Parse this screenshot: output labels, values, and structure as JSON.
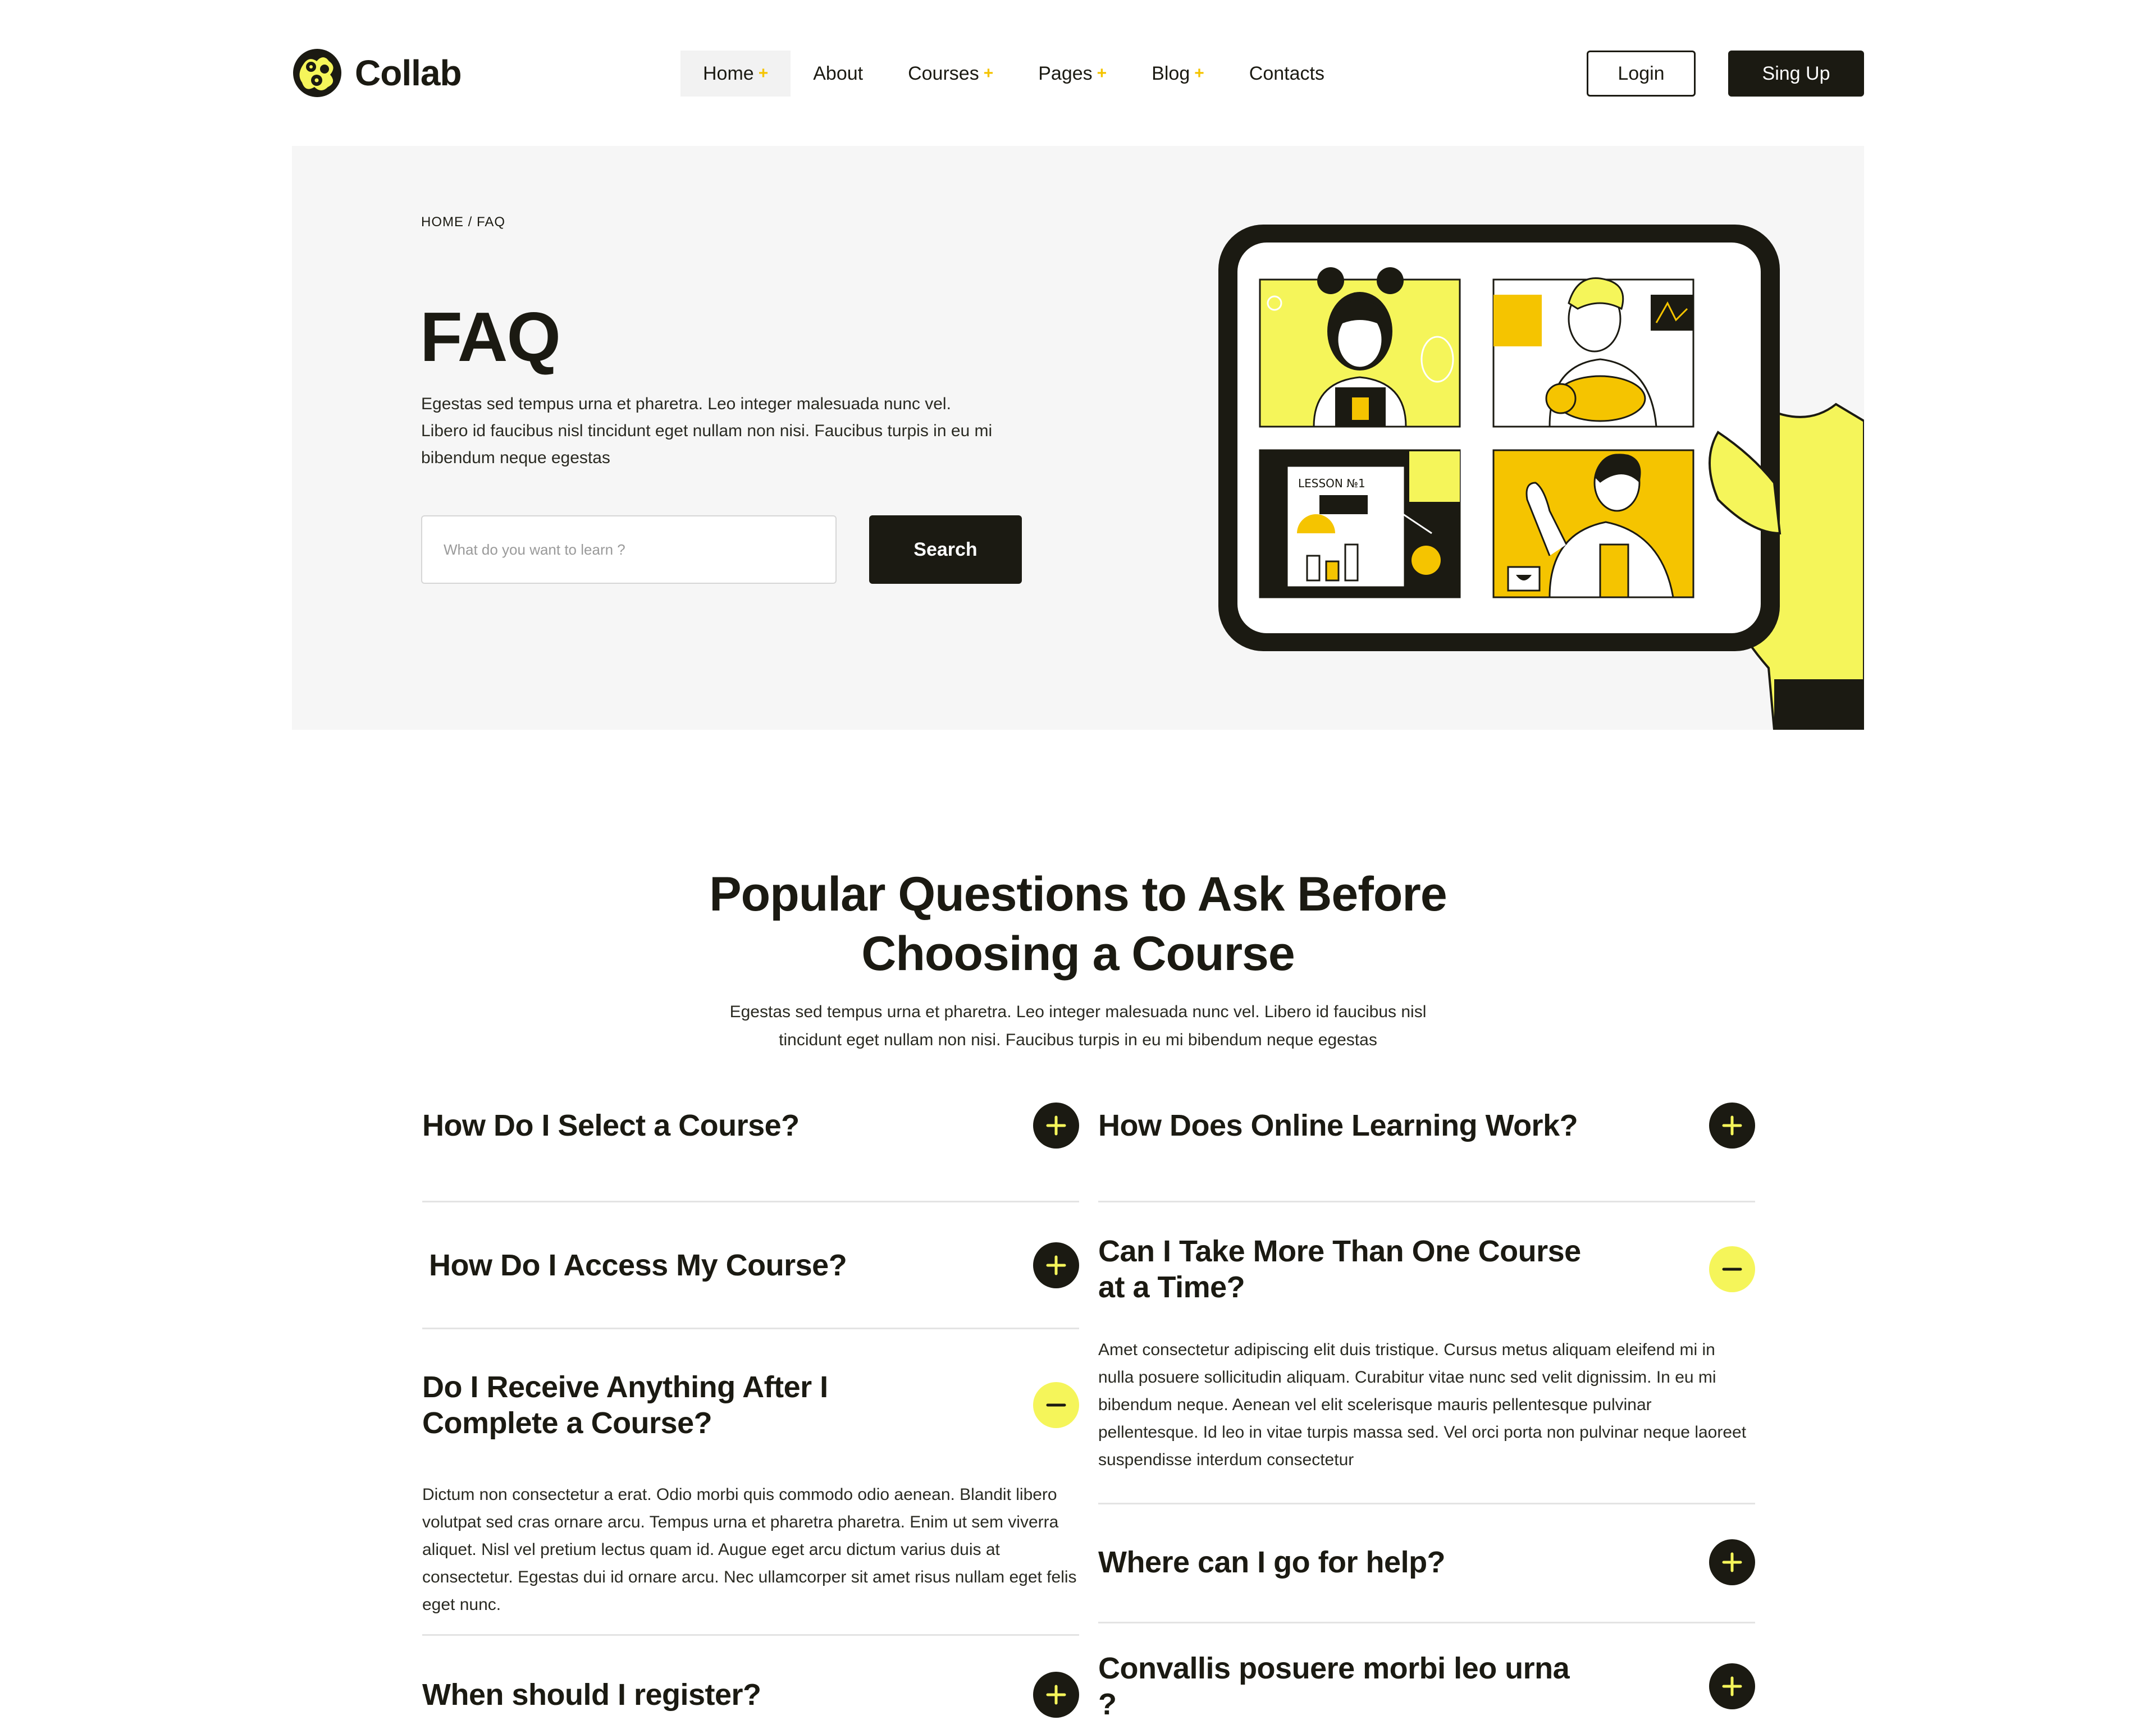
{
  "brand": {
    "name": "Collab",
    "accent": "#f5f55a",
    "dark": "#1b1a12",
    "plus_color": "#f5c400"
  },
  "nav": {
    "items": [
      {
        "label": "Home",
        "has_plus": true,
        "active": true
      },
      {
        "label": "About",
        "has_plus": false,
        "active": false
      },
      {
        "label": "Courses",
        "has_plus": true,
        "active": false
      },
      {
        "label": "Pages",
        "has_plus": true,
        "active": false
      },
      {
        "label": "Blog",
        "has_plus": true,
        "active": false
      },
      {
        "label": "Contacts",
        "has_plus": false,
        "active": false
      }
    ],
    "plus_symbol": "+",
    "login_label": "Login",
    "signup_label": "Sing Up"
  },
  "hero": {
    "breadcrumb": {
      "home": "HOME",
      "separator": "/",
      "current": "FAQ"
    },
    "title": "FAQ",
    "text": "Egestas sed tempus urna et pharetra. Leo integer malesuada nunc vel. Libero id faucibus nisl tincidunt eget nullam non nisi. Faucibus turpis in eu mi bibendum neque egestas",
    "search": {
      "placeholder": "What do you want to learn ?",
      "value": "",
      "button_label": "Search"
    },
    "illustration": {
      "lesson_label": "LESSON №1"
    }
  },
  "section": {
    "title_line1": "Popular Questions to Ask Before",
    "title_line2": "Choosing a Course",
    "subtitle": "Egestas sed tempus urna et pharetra. Leo integer malesuada nunc vel. Libero id faucibus nisl tincidunt eget nullam non nisi. Faucibus turpis in eu mi bibendum neque egestas"
  },
  "faq": {
    "left": [
      {
        "question": "How Do I Select a Course?",
        "open": false,
        "answer": ""
      },
      {
        "question": "How Do I Access My Course?",
        "open": false,
        "answer": ""
      },
      {
        "question": "Do I Receive Anything After I Complete a Course?",
        "open": true,
        "answer": "Dictum non consectetur a erat. Odio morbi quis commodo odio aenean. Blandit libero volutpat sed cras ornare arcu. Tempus urna et pharetra pharetra. Enim ut sem viverra aliquet. Nisl vel pretium lectus quam id. Augue eget arcu dictum varius duis at consectetur. Egestas dui id ornare arcu. Nec ullamcorper sit amet risus nullam eget felis eget nunc."
      },
      {
        "question": "When should I register?",
        "open": false,
        "answer": ""
      }
    ],
    "right": [
      {
        "question": "How Does Online Learning Work?",
        "open": false,
        "answer": ""
      },
      {
        "question": "Can I Take More Than One Course at a Time?",
        "open": true,
        "answer": "Amet consectetur adipiscing elit duis tristique. Cursus metus aliquam eleifend mi in nulla posuere sollicitudin aliquam. Curabitur vitae nunc sed velit dignissim. In eu mi bibendum neque. Aenean vel elit scelerisque mauris pellentesque pulvinar pellentesque. Id leo in vitae turpis massa sed. Vel orci porta non pulvinar neque laoreet suspendisse interdum consectetur"
      },
      {
        "question": "Where can I go for help?",
        "open": false,
        "answer": ""
      },
      {
        "question": "Convallis posuere morbi leo urna ?",
        "open": false,
        "answer": ""
      }
    ]
  }
}
